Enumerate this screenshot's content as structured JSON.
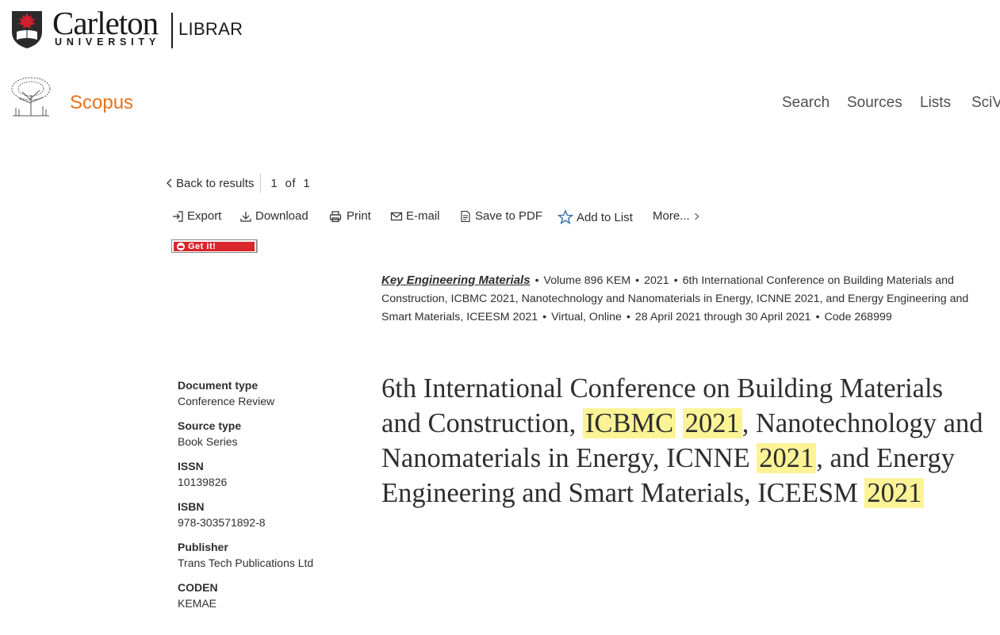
{
  "carleton": {
    "name": "Carleton",
    "university": "UNIVERSITY",
    "library": "LIBRARY",
    "crest_colors": {
      "shield": "#2b2b2b",
      "maple": "#d11f2e"
    }
  },
  "scopus": {
    "brand": "Scopus",
    "brand_color": "#e9711c",
    "nav": {
      "search": "Search",
      "sources": "Sources",
      "lists": "Lists",
      "scival": "SciVal"
    }
  },
  "results_nav": {
    "back_label": "Back to results",
    "pager": "1  of  1"
  },
  "toolbar": {
    "export": "Export",
    "download": "Download",
    "print": "Print",
    "email": "E-mail",
    "save_pdf": "Save to PDF",
    "add_to_list": "Add to List",
    "more": "More..."
  },
  "getit": {
    "label": "Get it!",
    "color": "#d8262c"
  },
  "source": {
    "title": "Key Engineering Materials",
    "volume": "Volume 896 KEM",
    "year": "2021",
    "conference": "6th International Conference on Building Materials and Construction, ICBMC 2021, Nanotechnology and Nanomaterials in Energy, ICNNE 2021, and Energy Engineering and Smart Materials, ICEESM 2021",
    "location": "Virtual, Online",
    "dates": "28 April 2021 through 30 April 2021",
    "code": "Code 268999"
  },
  "metadata": {
    "document_type_label": "Document type",
    "document_type": "Conference Review",
    "source_type_label": "Source type",
    "source_type": "Book Series",
    "issn_label": "ISSN",
    "issn": "10139826",
    "isbn_label": "ISBN",
    "isbn": "978-303571892-8",
    "publisher_label": "Publisher",
    "publisher": "Trans Tech Publications Ltd",
    "coden_label": "CODEN",
    "coden": "KEMAE"
  },
  "document_title": {
    "part1": "6th International Conference on Building Materials and Construction, ",
    "hl1": "ICBMC",
    "hl2": "2021",
    "part2": ", Nanotechnology and Nanomaterials in Energy, ICNNE ",
    "hl3": "2021",
    "part3": ", and Energy Engineering and Smart Materials, ICEESM ",
    "hl4": "2021",
    "highlight_color": "#fcf397"
  }
}
